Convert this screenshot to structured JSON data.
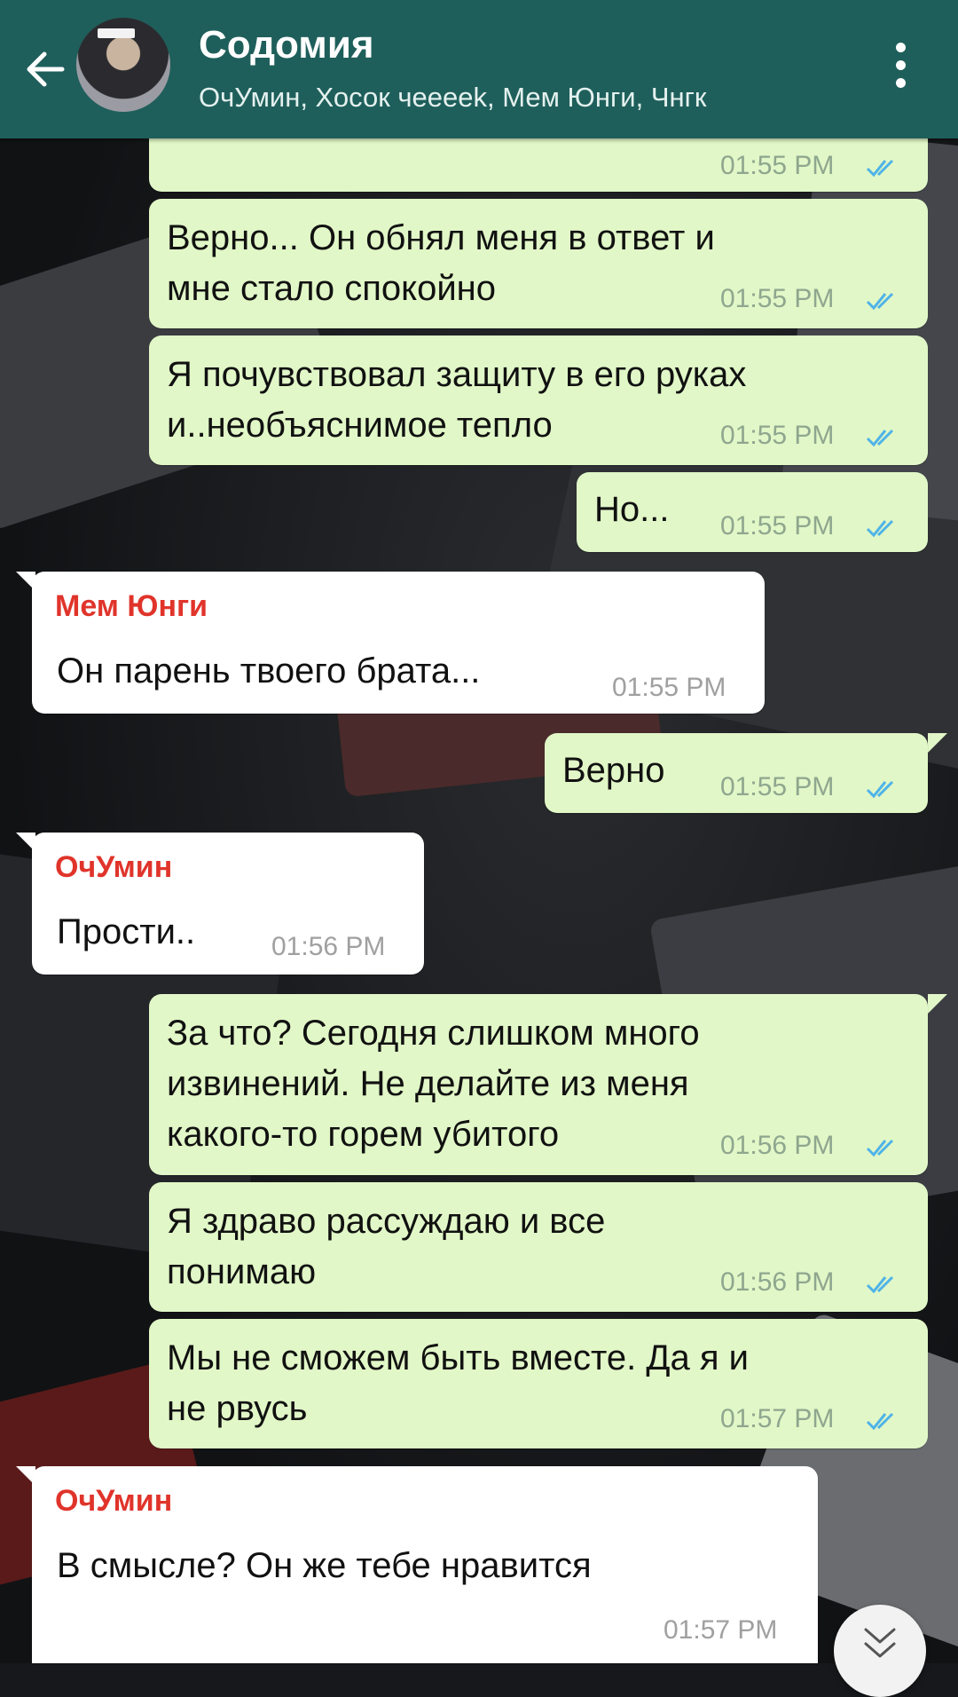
{
  "header": {
    "title": "Содомия",
    "subtitle": "ОчУмин, Хосок чееeek, Мем Юнги, Чнгк",
    "back_icon": "arrow-left-icon",
    "menu_icon": "more-vertical-icon",
    "color": "#1f5f5b"
  },
  "messages": [
    {
      "direction": "out",
      "text_lines": [],
      "time": "01:55 PM",
      "status": "read"
    },
    {
      "direction": "out",
      "text_lines": [
        "Верно... Он обнял меня в ответ и",
        "мне стало спокойно"
      ],
      "time": "01:55 PM",
      "status": "read"
    },
    {
      "direction": "out",
      "text_lines": [
        "Я почувствовал защиту в его руках",
        "и..необъяснимое тепло"
      ],
      "time": "01:55 PM",
      "status": "read"
    },
    {
      "direction": "out",
      "text_lines": [
        "Но..."
      ],
      "time": "01:55 PM",
      "status": "read"
    },
    {
      "direction": "in",
      "sender": "Мем Юнги",
      "text_lines": [
        "Он парень твоего брата..."
      ],
      "time": "01:55 PM"
    },
    {
      "direction": "out",
      "text_lines": [
        "Верно"
      ],
      "time": "01:55 PM",
      "status": "read"
    },
    {
      "direction": "in",
      "sender": "ОчУмин",
      "text_lines": [
        "Прости.."
      ],
      "time": "01:56 PM"
    },
    {
      "direction": "out",
      "text_lines": [
        "За что? Сегодня слишком много",
        "извинений. Не делайте из меня",
        "какого-то горем убитого"
      ],
      "time": "01:56 PM",
      "status": "read"
    },
    {
      "direction": "out",
      "text_lines": [
        "Я здраво рассуждаю и все",
        "понимаю"
      ],
      "time": "01:56 PM",
      "status": "read"
    },
    {
      "direction": "out",
      "text_lines": [
        "Мы не сможем быть вместе. Да я и",
        "не рвусь"
      ],
      "time": "01:57 PM",
      "status": "read"
    },
    {
      "direction": "in",
      "sender": "ОчУмин",
      "text_lines": [
        "В смысле? Он же тебе нравится"
      ],
      "time": "01:57 PM"
    }
  ],
  "colors": {
    "outgoing_bubble": "#e1f7c7",
    "incoming_bubble": "#ffffff",
    "sender_name": "#e0342b",
    "read_ticks": "#4fb3e8"
  },
  "scroll_button_icon": "double-chevron-down-icon"
}
